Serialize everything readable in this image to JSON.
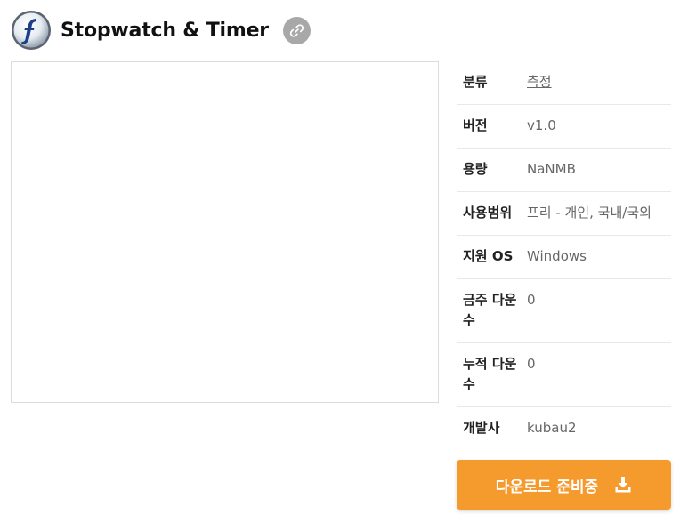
{
  "header": {
    "title": "Stopwatch & Timer",
    "logo_icon": "flash-logo-icon",
    "link_icon": "link-icon"
  },
  "info": {
    "category": {
      "label": "분류",
      "value": "측정"
    },
    "version": {
      "label": "버전",
      "value": "v1.0"
    },
    "size": {
      "label": "용량",
      "value": "NaNMB"
    },
    "license": {
      "label": "사용범위",
      "value": "프리 - 개인, 국내/국외"
    },
    "os": {
      "label": "지원 OS",
      "value": "Windows"
    },
    "weekly_downloads": {
      "label": "금주 다운수",
      "value": "0"
    },
    "total_downloads": {
      "label": "누적 다운수",
      "value": "0"
    },
    "developer": {
      "label": "개발사",
      "value": "kubau2"
    }
  },
  "download": {
    "label": "다운로드 준비중",
    "icon": "download-icon"
  },
  "colors": {
    "accent": "#f59a2c",
    "link_button_bg": "#a8a8a8",
    "divider": "#e8e8e8"
  }
}
